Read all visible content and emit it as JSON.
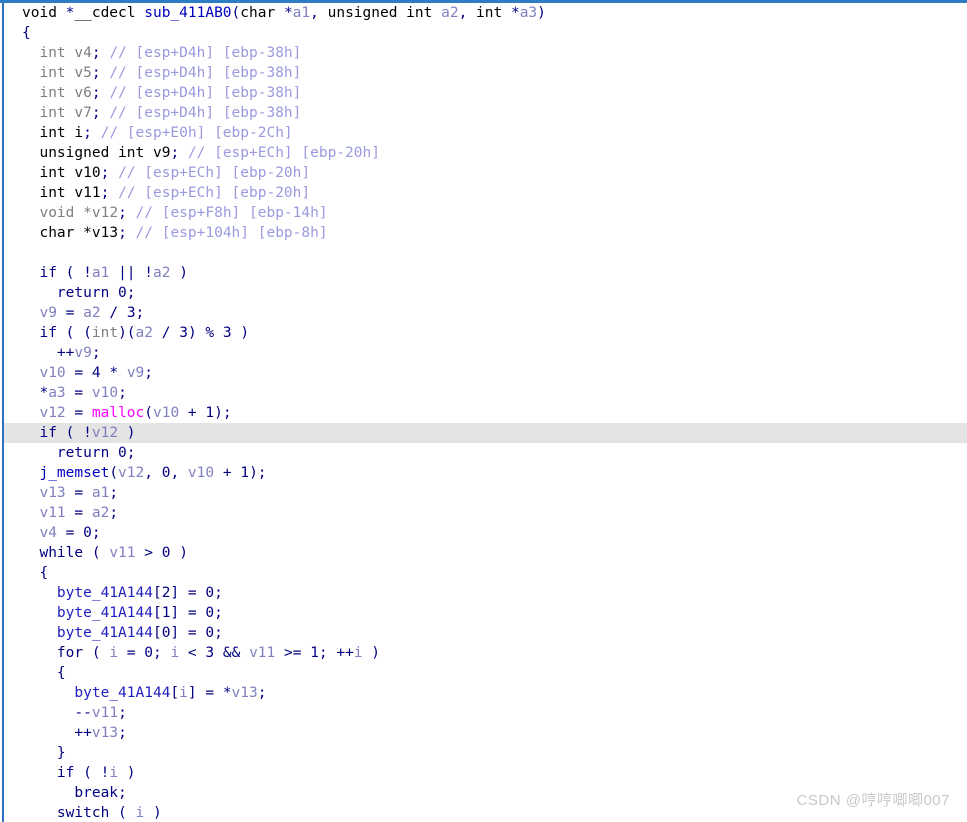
{
  "window": {
    "kind": "hex-rays-pseudocode-view",
    "accent_color": "#2e7cc3",
    "background_color": "#ffffff",
    "highlight_color": "#e4e4e4"
  },
  "watermark": {
    "text": "CSDN @哼哼唧唧007"
  },
  "function": {
    "name": "sub_411AB0",
    "return_type": "void *",
    "calling_convention": "__cdecl"
  },
  "code_lines": [
    {
      "id": "line-signature",
      "indent": 0,
      "highlighted": false,
      "tokens": [
        {
          "t": "void ",
          "c": "type"
        },
        {
          "t": "*",
          "c": "punc"
        },
        {
          "t": "__cdecl ",
          "c": "type"
        },
        {
          "t": "sub_411AB0",
          "c": "func"
        },
        {
          "t": "(",
          "c": "punc"
        },
        {
          "t": "char ",
          "c": "type"
        },
        {
          "t": "*",
          "c": "punc"
        },
        {
          "t": "a1",
          "c": "var"
        },
        {
          "t": ", ",
          "c": "punc"
        },
        {
          "t": "unsigned int ",
          "c": "type"
        },
        {
          "t": "a2",
          "c": "var"
        },
        {
          "t": ", ",
          "c": "punc"
        },
        {
          "t": "int ",
          "c": "type"
        },
        {
          "t": "*",
          "c": "punc"
        },
        {
          "t": "a3",
          "c": "var"
        },
        {
          "t": ")",
          "c": "punc"
        }
      ]
    },
    {
      "id": "line-open-brace-func",
      "indent": 0,
      "highlighted": false,
      "tokens": [
        {
          "t": "{",
          "c": "punc"
        }
      ]
    },
    {
      "id": "line-decl-v4",
      "indent": 1,
      "highlighted": false,
      "tokens": [
        {
          "t": "int ",
          "c": "typeu"
        },
        {
          "t": "v4",
          "c": "typeu"
        },
        {
          "t": ";",
          "c": "punc"
        },
        {
          "t": " ",
          "c": "punc"
        },
        {
          "t": "// [esp+D4h] [ebp-38h]",
          "c": "cmt"
        }
      ]
    },
    {
      "id": "line-decl-v5",
      "indent": 1,
      "highlighted": false,
      "tokens": [
        {
          "t": "int ",
          "c": "typeu"
        },
        {
          "t": "v5",
          "c": "typeu"
        },
        {
          "t": ";",
          "c": "punc"
        },
        {
          "t": " ",
          "c": "punc"
        },
        {
          "t": "// [esp+D4h] [ebp-38h]",
          "c": "cmt"
        }
      ]
    },
    {
      "id": "line-decl-v6",
      "indent": 1,
      "highlighted": false,
      "tokens": [
        {
          "t": "int ",
          "c": "typeu"
        },
        {
          "t": "v6",
          "c": "typeu"
        },
        {
          "t": ";",
          "c": "punc"
        },
        {
          "t": " ",
          "c": "punc"
        },
        {
          "t": "// [esp+D4h] [ebp-38h]",
          "c": "cmt"
        }
      ]
    },
    {
      "id": "line-decl-v7",
      "indent": 1,
      "highlighted": false,
      "tokens": [
        {
          "t": "int ",
          "c": "typeu"
        },
        {
          "t": "v7",
          "c": "typeu"
        },
        {
          "t": ";",
          "c": "punc"
        },
        {
          "t": " ",
          "c": "punc"
        },
        {
          "t": "// [esp+D4h] [ebp-38h]",
          "c": "cmt"
        }
      ]
    },
    {
      "id": "line-decl-i",
      "indent": 1,
      "highlighted": false,
      "tokens": [
        {
          "t": "int ",
          "c": "type"
        },
        {
          "t": "i",
          "c": "type"
        },
        {
          "t": ";",
          "c": "punc"
        },
        {
          "t": " ",
          "c": "punc"
        },
        {
          "t": "// [esp+E0h] [ebp-2Ch]",
          "c": "cmt"
        }
      ]
    },
    {
      "id": "line-decl-v9",
      "indent": 1,
      "highlighted": false,
      "tokens": [
        {
          "t": "unsigned int ",
          "c": "type"
        },
        {
          "t": "v9",
          "c": "type"
        },
        {
          "t": ";",
          "c": "punc"
        },
        {
          "t": " ",
          "c": "punc"
        },
        {
          "t": "// [esp+ECh] [ebp-20h]",
          "c": "cmt"
        }
      ]
    },
    {
      "id": "line-decl-v10",
      "indent": 1,
      "highlighted": false,
      "tokens": [
        {
          "t": "int ",
          "c": "type"
        },
        {
          "t": "v10",
          "c": "type"
        },
        {
          "t": ";",
          "c": "punc"
        },
        {
          "t": " ",
          "c": "punc"
        },
        {
          "t": "// [esp+ECh] [ebp-20h]",
          "c": "cmt"
        }
      ]
    },
    {
      "id": "line-decl-v11",
      "indent": 1,
      "highlighted": false,
      "tokens": [
        {
          "t": "int ",
          "c": "type"
        },
        {
          "t": "v11",
          "c": "type"
        },
        {
          "t": ";",
          "c": "punc"
        },
        {
          "t": " ",
          "c": "punc"
        },
        {
          "t": "// [esp+ECh] [ebp-20h]",
          "c": "cmt"
        }
      ]
    },
    {
      "id": "line-decl-v12",
      "indent": 1,
      "highlighted": false,
      "tokens": [
        {
          "t": "void ",
          "c": "typeu"
        },
        {
          "t": "*",
          "c": "typeu"
        },
        {
          "t": "v12",
          "c": "typeu"
        },
        {
          "t": ";",
          "c": "punc"
        },
        {
          "t": " ",
          "c": "punc"
        },
        {
          "t": "// [esp+F8h] [ebp-14h]",
          "c": "cmt"
        }
      ]
    },
    {
      "id": "line-decl-v13",
      "indent": 1,
      "highlighted": false,
      "tokens": [
        {
          "t": "char ",
          "c": "type"
        },
        {
          "t": "*",
          "c": "type"
        },
        {
          "t": "v13",
          "c": "type"
        },
        {
          "t": ";",
          "c": "punc"
        },
        {
          "t": " ",
          "c": "punc"
        },
        {
          "t": "// [esp+104h] [ebp-8h]",
          "c": "cmt"
        }
      ]
    },
    {
      "id": "line-blank-1",
      "indent": 0,
      "highlighted": false,
      "tokens": [
        {
          "t": " ",
          "c": "punc"
        }
      ]
    },
    {
      "id": "line-if-a1-a2",
      "indent": 1,
      "highlighted": false,
      "tokens": [
        {
          "t": "if",
          "c": "kw"
        },
        {
          "t": " ( ",
          "c": "punc"
        },
        {
          "t": "!",
          "c": "punc"
        },
        {
          "t": "a1",
          "c": "var"
        },
        {
          "t": " || ",
          "c": "punc"
        },
        {
          "t": "!",
          "c": "punc"
        },
        {
          "t": "a2",
          "c": "var"
        },
        {
          "t": " )",
          "c": "punc"
        }
      ]
    },
    {
      "id": "line-return-0-a",
      "indent": 2,
      "highlighted": false,
      "tokens": [
        {
          "t": "return",
          "c": "kw"
        },
        {
          "t": " ",
          "c": "punc"
        },
        {
          "t": "0",
          "c": "num"
        },
        {
          "t": ";",
          "c": "punc"
        }
      ]
    },
    {
      "id": "line-v9-assign",
      "indent": 1,
      "highlighted": false,
      "tokens": [
        {
          "t": "v9",
          "c": "var"
        },
        {
          "t": " = ",
          "c": "punc"
        },
        {
          "t": "a2",
          "c": "var"
        },
        {
          "t": " / ",
          "c": "punc"
        },
        {
          "t": "3",
          "c": "num"
        },
        {
          "t": ";",
          "c": "punc"
        }
      ]
    },
    {
      "id": "line-if-mod3",
      "indent": 1,
      "highlighted": false,
      "tokens": [
        {
          "t": "if",
          "c": "kw"
        },
        {
          "t": " ( (",
          "c": "punc"
        },
        {
          "t": "int",
          "c": "typeu"
        },
        {
          "t": ")(",
          "c": "punc"
        },
        {
          "t": "a2",
          "c": "var"
        },
        {
          "t": " / ",
          "c": "punc"
        },
        {
          "t": "3",
          "c": "num"
        },
        {
          "t": ") % ",
          "c": "punc"
        },
        {
          "t": "3",
          "c": "num"
        },
        {
          "t": " )",
          "c": "punc"
        }
      ]
    },
    {
      "id": "line-inc-v9",
      "indent": 2,
      "highlighted": false,
      "tokens": [
        {
          "t": "++",
          "c": "punc"
        },
        {
          "t": "v9",
          "c": "var"
        },
        {
          "t": ";",
          "c": "punc"
        }
      ]
    },
    {
      "id": "line-v10-assign",
      "indent": 1,
      "highlighted": false,
      "tokens": [
        {
          "t": "v10",
          "c": "var"
        },
        {
          "t": " = ",
          "c": "punc"
        },
        {
          "t": "4",
          "c": "num"
        },
        {
          "t": " * ",
          "c": "punc"
        },
        {
          "t": "v9",
          "c": "var"
        },
        {
          "t": ";",
          "c": "punc"
        }
      ]
    },
    {
      "id": "line-a3-assign",
      "indent": 1,
      "highlighted": false,
      "tokens": [
        {
          "t": "*",
          "c": "punc"
        },
        {
          "t": "a3",
          "c": "var"
        },
        {
          "t": " = ",
          "c": "punc"
        },
        {
          "t": "v10",
          "c": "var"
        },
        {
          "t": ";",
          "c": "punc"
        }
      ]
    },
    {
      "id": "line-malloc",
      "indent": 1,
      "highlighted": false,
      "tokens": [
        {
          "t": "v12",
          "c": "var"
        },
        {
          "t": " = ",
          "c": "punc"
        },
        {
          "t": "malloc",
          "c": "imp"
        },
        {
          "t": "(",
          "c": "punc"
        },
        {
          "t": "v10",
          "c": "var"
        },
        {
          "t": " + ",
          "c": "punc"
        },
        {
          "t": "1",
          "c": "num"
        },
        {
          "t": ");",
          "c": "punc"
        }
      ]
    },
    {
      "id": "line-if-v12",
      "indent": 1,
      "highlighted": true,
      "tokens": [
        {
          "t": "if",
          "c": "kw"
        },
        {
          "t": " ( ",
          "c": "punc"
        },
        {
          "t": "!",
          "c": "punc"
        },
        {
          "t": "v12",
          "c": "var"
        },
        {
          "t": " )",
          "c": "punc"
        }
      ]
    },
    {
      "id": "line-return-0-b",
      "indent": 2,
      "highlighted": false,
      "tokens": [
        {
          "t": "return",
          "c": "kw"
        },
        {
          "t": " ",
          "c": "punc"
        },
        {
          "t": "0",
          "c": "num"
        },
        {
          "t": ";",
          "c": "punc"
        }
      ]
    },
    {
      "id": "line-memset",
      "indent": 1,
      "highlighted": false,
      "tokens": [
        {
          "t": "j_memset",
          "c": "func"
        },
        {
          "t": "(",
          "c": "punc"
        },
        {
          "t": "v12",
          "c": "var"
        },
        {
          "t": ", ",
          "c": "punc"
        },
        {
          "t": "0",
          "c": "num"
        },
        {
          "t": ", ",
          "c": "punc"
        },
        {
          "t": "v10",
          "c": "var"
        },
        {
          "t": " + ",
          "c": "punc"
        },
        {
          "t": "1",
          "c": "num"
        },
        {
          "t": ");",
          "c": "punc"
        }
      ]
    },
    {
      "id": "line-v13-assign",
      "indent": 1,
      "highlighted": false,
      "tokens": [
        {
          "t": "v13",
          "c": "var"
        },
        {
          "t": " = ",
          "c": "punc"
        },
        {
          "t": "a1",
          "c": "var"
        },
        {
          "t": ";",
          "c": "punc"
        }
      ]
    },
    {
      "id": "line-v11-assign",
      "indent": 1,
      "highlighted": false,
      "tokens": [
        {
          "t": "v11",
          "c": "var"
        },
        {
          "t": " = ",
          "c": "punc"
        },
        {
          "t": "a2",
          "c": "var"
        },
        {
          "t": ";",
          "c": "punc"
        }
      ]
    },
    {
      "id": "line-v4-assign",
      "indent": 1,
      "highlighted": false,
      "tokens": [
        {
          "t": "v4",
          "c": "var"
        },
        {
          "t": " = ",
          "c": "punc"
        },
        {
          "t": "0",
          "c": "num"
        },
        {
          "t": ";",
          "c": "punc"
        }
      ]
    },
    {
      "id": "line-while",
      "indent": 1,
      "highlighted": false,
      "tokens": [
        {
          "t": "while",
          "c": "kw"
        },
        {
          "t": " ( ",
          "c": "punc"
        },
        {
          "t": "v11",
          "c": "var"
        },
        {
          "t": " > ",
          "c": "punc"
        },
        {
          "t": "0",
          "c": "num"
        },
        {
          "t": " )",
          "c": "punc"
        }
      ]
    },
    {
      "id": "line-open-brace-while",
      "indent": 1,
      "highlighted": false,
      "tokens": [
        {
          "t": "{",
          "c": "punc"
        }
      ]
    },
    {
      "id": "line-byte2",
      "indent": 2,
      "highlighted": false,
      "tokens": [
        {
          "t": "byte_41A144",
          "c": "glob"
        },
        {
          "t": "[",
          "c": "punc"
        },
        {
          "t": "2",
          "c": "num"
        },
        {
          "t": "] = ",
          "c": "punc"
        },
        {
          "t": "0",
          "c": "num"
        },
        {
          "t": ";",
          "c": "punc"
        }
      ]
    },
    {
      "id": "line-byte1",
      "indent": 2,
      "highlighted": false,
      "tokens": [
        {
          "t": "byte_41A144",
          "c": "glob"
        },
        {
          "t": "[",
          "c": "punc"
        },
        {
          "t": "1",
          "c": "num"
        },
        {
          "t": "] = ",
          "c": "punc"
        },
        {
          "t": "0",
          "c": "num"
        },
        {
          "t": ";",
          "c": "punc"
        }
      ]
    },
    {
      "id": "line-byte0",
      "indent": 2,
      "highlighted": false,
      "tokens": [
        {
          "t": "byte_41A144",
          "c": "glob"
        },
        {
          "t": "[",
          "c": "punc"
        },
        {
          "t": "0",
          "c": "num"
        },
        {
          "t": "] = ",
          "c": "punc"
        },
        {
          "t": "0",
          "c": "num"
        },
        {
          "t": ";",
          "c": "punc"
        }
      ]
    },
    {
      "id": "line-for",
      "indent": 2,
      "highlighted": false,
      "tokens": [
        {
          "t": "for",
          "c": "kw"
        },
        {
          "t": " ( ",
          "c": "punc"
        },
        {
          "t": "i",
          "c": "var"
        },
        {
          "t": " = ",
          "c": "punc"
        },
        {
          "t": "0",
          "c": "num"
        },
        {
          "t": "; ",
          "c": "punc"
        },
        {
          "t": "i",
          "c": "var"
        },
        {
          "t": " < ",
          "c": "punc"
        },
        {
          "t": "3",
          "c": "num"
        },
        {
          "t": " && ",
          "c": "punc"
        },
        {
          "t": "v11",
          "c": "var"
        },
        {
          "t": " >= ",
          "c": "punc"
        },
        {
          "t": "1",
          "c": "num"
        },
        {
          "t": "; ++",
          "c": "punc"
        },
        {
          "t": "i",
          "c": "var"
        },
        {
          "t": " )",
          "c": "punc"
        }
      ]
    },
    {
      "id": "line-open-brace-for",
      "indent": 2,
      "highlighted": false,
      "tokens": [
        {
          "t": "{",
          "c": "punc"
        }
      ]
    },
    {
      "id": "line-byte-i",
      "indent": 3,
      "highlighted": false,
      "tokens": [
        {
          "t": "byte_41A144",
          "c": "glob"
        },
        {
          "t": "[",
          "c": "punc"
        },
        {
          "t": "i",
          "c": "var"
        },
        {
          "t": "] = ",
          "c": "punc"
        },
        {
          "t": "*",
          "c": "punc"
        },
        {
          "t": "v13",
          "c": "var"
        },
        {
          "t": ";",
          "c": "punc"
        }
      ]
    },
    {
      "id": "line-dec-v11",
      "indent": 3,
      "highlighted": false,
      "tokens": [
        {
          "t": "--",
          "c": "punc"
        },
        {
          "t": "v11",
          "c": "var"
        },
        {
          "t": ";",
          "c": "punc"
        }
      ]
    },
    {
      "id": "line-inc-v13",
      "indent": 3,
      "highlighted": false,
      "tokens": [
        {
          "t": "++",
          "c": "punc"
        },
        {
          "t": "v13",
          "c": "var"
        },
        {
          "t": ";",
          "c": "punc"
        }
      ]
    },
    {
      "id": "line-close-brace-for",
      "indent": 2,
      "highlighted": false,
      "tokens": [
        {
          "t": "}",
          "c": "punc"
        }
      ]
    },
    {
      "id": "line-if-not-i",
      "indent": 2,
      "highlighted": false,
      "tokens": [
        {
          "t": "if",
          "c": "kw"
        },
        {
          "t": " ( ",
          "c": "punc"
        },
        {
          "t": "!",
          "c": "punc"
        },
        {
          "t": "i",
          "c": "var"
        },
        {
          "t": " )",
          "c": "punc"
        }
      ]
    },
    {
      "id": "line-break",
      "indent": 3,
      "highlighted": false,
      "tokens": [
        {
          "t": "break",
          "c": "kw"
        },
        {
          "t": ";",
          "c": "punc"
        }
      ]
    },
    {
      "id": "line-switch",
      "indent": 2,
      "highlighted": false,
      "tokens": [
        {
          "t": "switch",
          "c": "kw"
        },
        {
          "t": " ( ",
          "c": "punc"
        },
        {
          "t": "i",
          "c": "var"
        },
        {
          "t": " )",
          "c": "punc"
        }
      ]
    }
  ]
}
